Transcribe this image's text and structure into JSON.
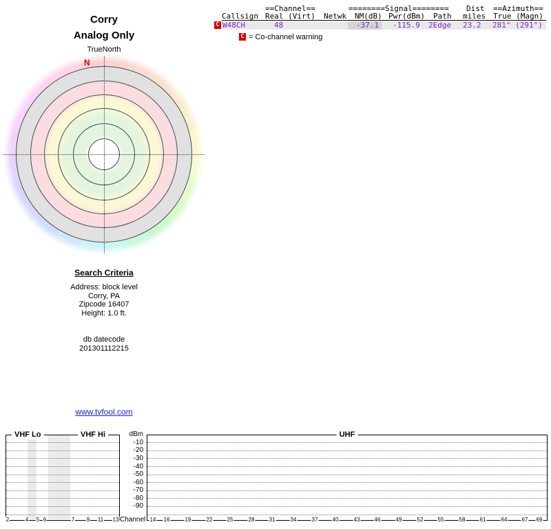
{
  "title": {
    "line1": "Corry",
    "line2": "Analog Only"
  },
  "polar": {
    "axis_label": "TrueNorth",
    "north_marker": "N"
  },
  "table": {
    "header": {
      "channel_group": "==Channel==",
      "signal_group": "========Signal========",
      "dist_group": "Dist",
      "azimuth_group": "==Azimuth==",
      "callsign": "Callsign",
      "real_virt": "Real (Virt)",
      "netwk": "Netwk",
      "nm_db": "NM(dB)",
      "pwr_dbm": "Pwr(dBm)",
      "path": "Path",
      "miles": "miles",
      "true_magn": "True (Magn)"
    },
    "rows": [
      {
        "flag": "C",
        "callsign": "W48CH",
        "real": "48",
        "virt": "",
        "netwk": "",
        "nm_db": "-37.1",
        "pwr_dbm": "-115.9",
        "path": "2Edge",
        "miles": "23.2",
        "azimuth": "281° (291°)"
      }
    ],
    "legend": {
      "flag": "C",
      "text": "= Co-channel warning"
    }
  },
  "criteria": {
    "heading": "Search Criteria",
    "lines": [
      "Address: block level",
      "Corry, PA",
      "Zipcode 16407",
      "Height: 1.0 ft."
    ],
    "datecode_label": "db datecode",
    "datecode_value": "201301112215"
  },
  "link": {
    "text": "www.tvfool.com"
  },
  "chart_data": {
    "type": "line",
    "title": "Analog signal strength by TV channel (no signals within plotted range)",
    "ylabel": "dBm",
    "xlabel": "Channel",
    "y_ticks": [
      -10,
      -20,
      -30,
      -40,
      -50,
      -60,
      -70,
      -80,
      -90
    ],
    "ylim": [
      -100,
      0
    ],
    "grid": "dotted-horizontal",
    "legend_position": "none",
    "series": [],
    "panels": [
      {
        "label_left": "VHF Lo",
        "label_right": "VHF Hi",
        "channels": [
          2,
          4,
          5,
          6,
          7,
          9,
          11,
          13
        ],
        "shaded_gaps": [
          [
            4,
            5
          ],
          [
            6,
            7
          ]
        ]
      },
      {
        "label": "UHF",
        "channels": [
          14,
          16,
          19,
          22,
          25,
          28,
          31,
          34,
          37,
          40,
          43,
          46,
          49,
          52,
          55,
          58,
          61,
          64,
          67,
          69
        ],
        "shaded_gaps": []
      }
    ]
  },
  "colors": {
    "value_text": "#7B24CC",
    "flag_red": "#D40000",
    "link_blue": "#2222CC",
    "row_bg": "#E9E9E9",
    "nm_cell_bg": "#D4D4D4",
    "ring_gray": "#E1E1E1",
    "ring_pink": "#FBDCE1",
    "ring_yellow": "#FAF8D6",
    "ring_green": "#E3F5DF"
  }
}
